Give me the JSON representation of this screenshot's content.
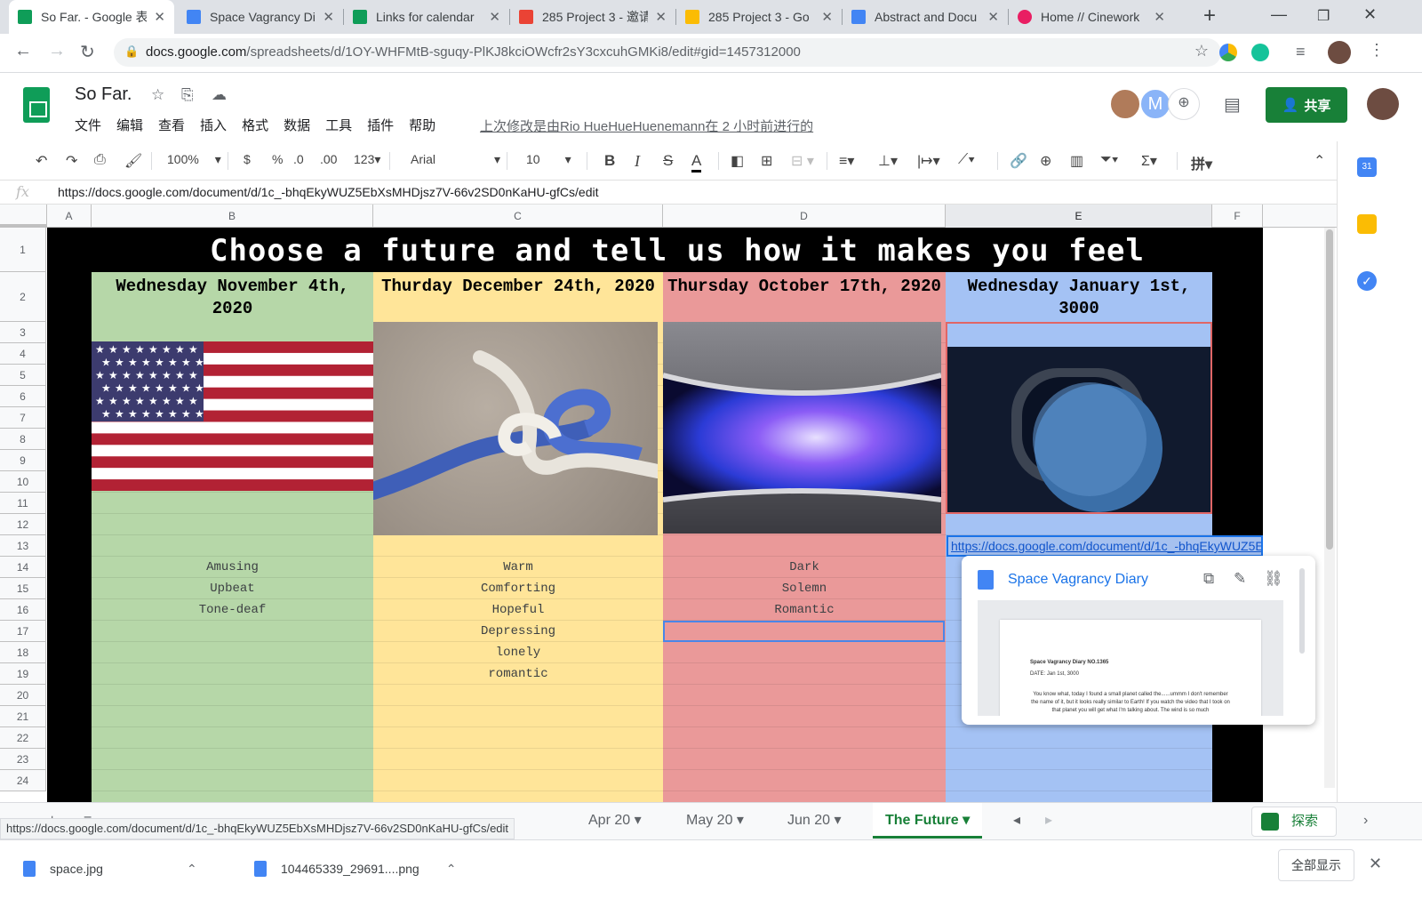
{
  "browser": {
    "tabs": [
      {
        "title": "So Far. - Google 表",
        "favicon_color": "#0f9d58",
        "active": true
      },
      {
        "title": "Space Vagrancy Di",
        "favicon_color": "#4285f4",
        "active": false
      },
      {
        "title": "Links for calendar",
        "favicon_color": "#0f9d58",
        "active": false
      },
      {
        "title": "285 Project 3 - 邀请",
        "favicon_color": "#ea4335",
        "active": false
      },
      {
        "title": "285 Project 3 - Go",
        "favicon_color": "#fbbc04",
        "active": false
      },
      {
        "title": "Abstract and Docu",
        "favicon_color": "#4285f4",
        "active": false
      },
      {
        "title": "Home // Cinework",
        "favicon_color": "#e91e63",
        "active": false
      }
    ],
    "url_domain": "docs.google.com",
    "url_path": "/spreadsheets/d/1OY-WHFMtB-sguqy-PlKJ8kciOWcfr2sY3cxcuhGMKi8/edit#gid=1457312000"
  },
  "doc": {
    "title": "So Far.",
    "menus": [
      "文件",
      "编辑",
      "查看",
      "插入",
      "格式",
      "数据",
      "工具",
      "插件",
      "帮助"
    ],
    "last_edit": "上次修改是由Rio HueHueHuenemann在 2 小时前进行的",
    "share_label": "共享"
  },
  "toolbar": {
    "zoom": "100%",
    "currency": "$",
    "percent": "%",
    "dec_decrease": ".0",
    "dec_increase": ".00",
    "number_format": "123",
    "font": "Arial",
    "font_size": "10",
    "bold": "B",
    "italic": "I",
    "strike": "S",
    "text_color": "A"
  },
  "formula_bar": {
    "fx": "fx",
    "content": "https://docs.google.com/document/d/1c_-bhqEkyWUZ5EbXsMHDjsz7V-66v2SD0nKaHU-gfCs/edit"
  },
  "columns": [
    "A",
    "B",
    "C",
    "D",
    "E",
    "F"
  ],
  "rows": [
    "1",
    "2",
    "3",
    "4",
    "5",
    "6",
    "7",
    "8",
    "9",
    "10",
    "11",
    "12",
    "13",
    "14",
    "15",
    "16",
    "17",
    "18",
    "19",
    "20",
    "21",
    "22",
    "23",
    "24"
  ],
  "sheet": {
    "banner": "Choose a future and tell us how it makes you feel",
    "futures": [
      {
        "date": "Wednesday November 4th, 2020",
        "color": "#b6d7a8",
        "feelings": [
          "Amusing",
          "Upbeat",
          "Tone-deaf"
        ],
        "image": "american-flag"
      },
      {
        "date": "Thurday December 24th, 2020",
        "color": "#ffe599",
        "feelings": [
          "Warm",
          "Comforting",
          "Hopeful",
          "Depressing",
          "lonely",
          "romantic"
        ],
        "image": "rope-knot"
      },
      {
        "date": "Thursday October 17th, 2920",
        "color": "#ea9999",
        "feelings": [
          "Dark",
          "Solemn",
          "Romantic"
        ],
        "image": "space-station-window"
      },
      {
        "date": "Wednesday January 1st, 3000",
        "color": "#a4c2f4",
        "feelings": [],
        "image": "planet-porthole"
      }
    ],
    "link_cell": "https://docs.google.com/document/d/1c_-bhqEkyWUZ5EbXsMHDjsz7V-66v2SD0nKaHU-gfCs/edit"
  },
  "link_preview": {
    "title": "Space Vagrancy Diary",
    "doc_heading": "Space Vagrancy Diary NO.1365",
    "doc_date": "DATE: Jan 1st, 3000",
    "doc_body": "You know what, today I found a small planet called the......ummm I don't remember the name of it, but it looks really similar to Earth! If you watch the video that I took on that planet you will get what I'm talking about. The wind is so much"
  },
  "sheet_tabs": [
    "Apr 20",
    "May 20",
    "Jun 20",
    "The Future"
  ],
  "active_sheet_tab": "The Future",
  "explore_label": "探索",
  "status_url": "https://docs.google.com/document/d/1c_-bhqEkyWUZ5EbXsMHDjsz7V-66v2SD0nKaHU-gfCs/edit",
  "downloads": [
    {
      "name": "space.jpg"
    },
    {
      "name": "104465339_29691....png"
    }
  ],
  "show_all_label": "全部显示"
}
